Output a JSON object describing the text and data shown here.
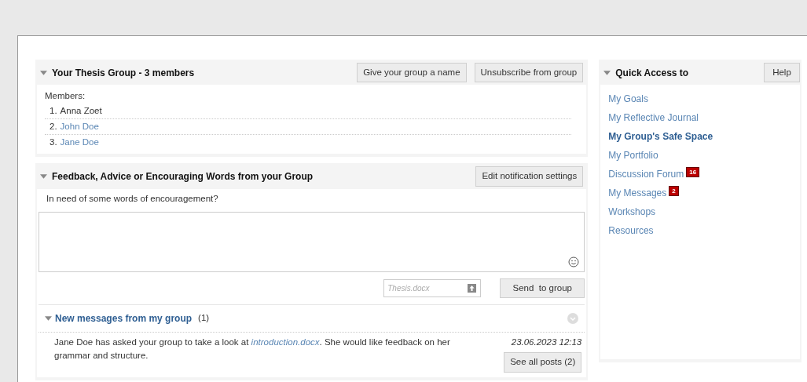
{
  "group_panel": {
    "title": "Your Thesis Group - 3 members",
    "expanded": true,
    "buttons": [
      "Give your group a name",
      "Unsubscribe from group"
    ],
    "members_label": "Members:",
    "members": [
      {
        "number": "1.",
        "name": "Anna Zoet",
        "link": false
      },
      {
        "number": "2.",
        "name": "John Doe",
        "link": true
      },
      {
        "number": "3.",
        "name": "Jane Doe",
        "link": true
      }
    ]
  },
  "feedback_panel": {
    "title": "Feedback, Advice or Encouraging Words from your Group",
    "expanded": true,
    "button": "Edit notification settings",
    "prompt": "In need of some words of encouragement?",
    "attachment": {
      "placeholder": "Thesis.docx"
    },
    "send_button": "Send  to group",
    "messages": {
      "title": "New messages from my group",
      "count": "(1)",
      "expanded": true,
      "text_start": "Jane Doe has asked your group to take a look at",
      "link_text": "introduction.docx",
      "text_end": ". She would like feedback on her grammar and structure.",
      "date": "23.06.2023 12:13",
      "button": "See all posts (2)"
    }
  },
  "quick_access": {
    "title": "Quick Access to",
    "expanded": true,
    "button": "Help",
    "items": [
      {
        "label": "My Goals",
        "selected": false
      },
      {
        "label": "My Reflective Journal",
        "selected": false
      },
      {
        "label": "My Group's Safe Space",
        "selected": true
      },
      {
        "label": "My Portfolio",
        "selected": false
      },
      {
        "label": "Discussion Forum",
        "selected": false,
        "badge": "16"
      },
      {
        "label": "My Messages",
        "selected": false,
        "badge": "2"
      },
      {
        "label": "Workshops",
        "selected": false
      },
      {
        "label": "Resources",
        "selected": false
      }
    ]
  }
}
